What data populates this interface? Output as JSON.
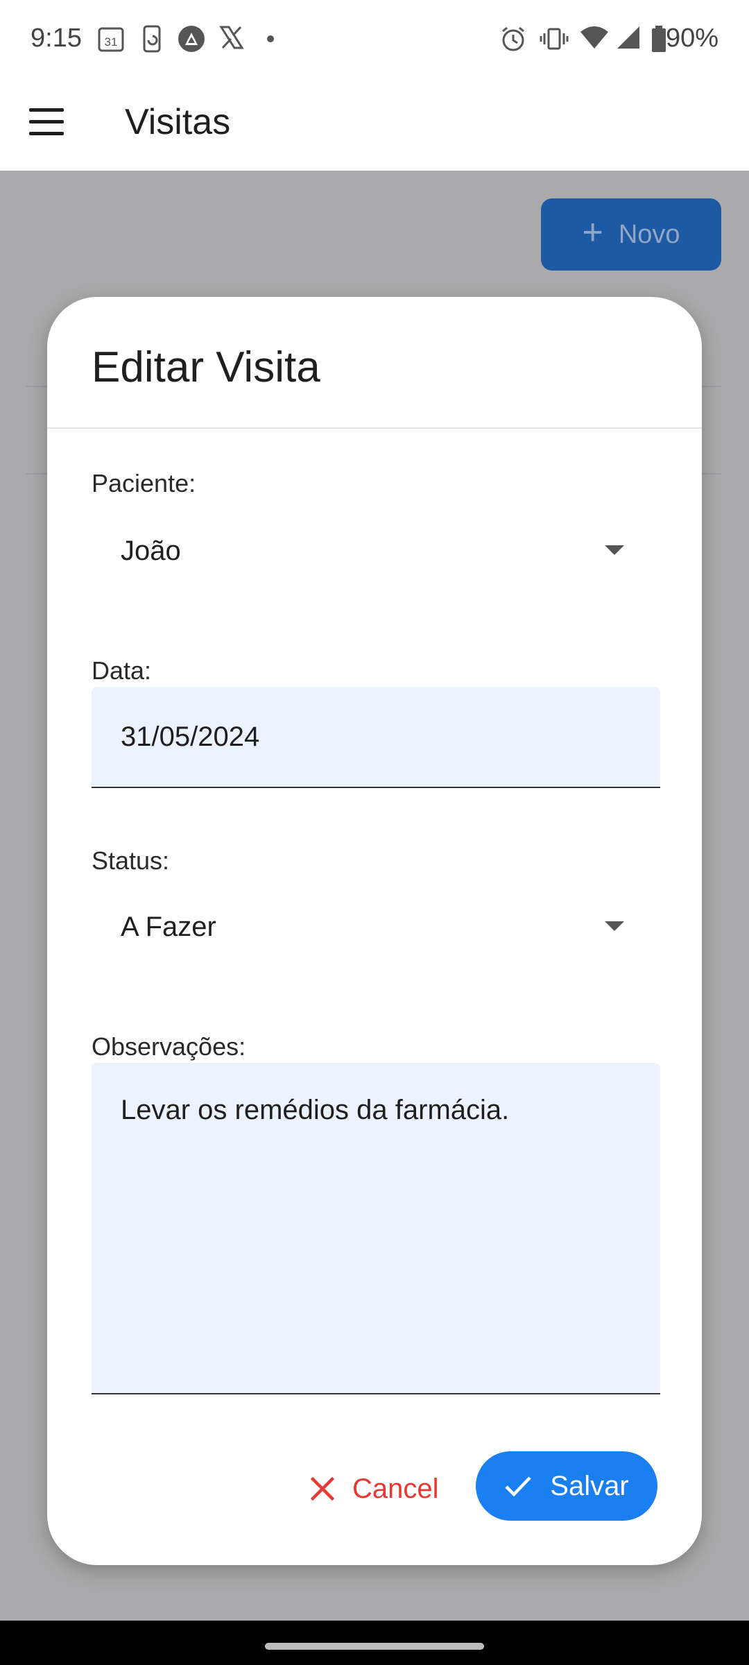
{
  "status_bar": {
    "time": "9:15",
    "battery": "90%",
    "left_icons": [
      "calendar-31-icon",
      "phone-sync-icon",
      "app-a-icon",
      "x-logo-icon",
      "dot-icon"
    ],
    "right_icons": [
      "alarm-icon",
      "vibrate-icon",
      "wifi-icon",
      "signal-icon",
      "battery-icon"
    ],
    "calendar_day": "31"
  },
  "app_bar": {
    "title": "Visitas",
    "menu_icon": "hamburger-menu-icon"
  },
  "background": {
    "new_button_label": "Novo"
  },
  "dialog": {
    "title": "Editar Visita",
    "patient": {
      "label": "Paciente:",
      "value": "João"
    },
    "date": {
      "label": "Data:",
      "value": "31/05/2024"
    },
    "status": {
      "label": "Status:",
      "value": "A Fazer"
    },
    "notes": {
      "label": "Observações:",
      "value": "Levar os remédios da farmácia."
    },
    "cancel_label": "Cancel",
    "save_label": "Salvar"
  },
  "colors": {
    "primary": "#1a7ff0",
    "cancel": "#e53935",
    "field_bg": "#ebf3fe",
    "scrim": "#aaaaac"
  }
}
